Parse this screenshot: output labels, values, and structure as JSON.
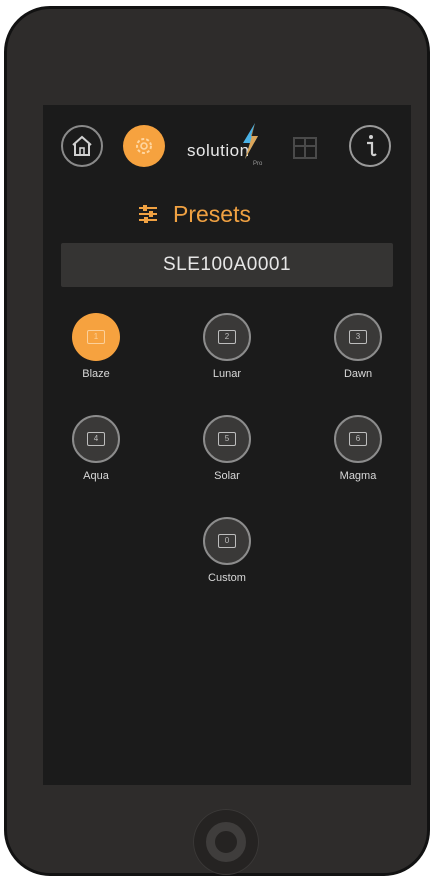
{
  "logo": {
    "text": "solution",
    "sub": "Pro"
  },
  "header": {
    "title": "Presets"
  },
  "device": {
    "id": "SLE100A0001"
  },
  "presets": [
    {
      "label": "Blaze",
      "number": "1",
      "active": true
    },
    {
      "label": "Lunar",
      "number": "2",
      "active": false
    },
    {
      "label": "Dawn",
      "number": "3",
      "active": false
    },
    {
      "label": "Aqua",
      "number": "4",
      "active": false
    },
    {
      "label": "Solar",
      "number": "5",
      "active": false
    },
    {
      "label": "Magma",
      "number": "6",
      "active": false
    },
    {
      "label": "Custom",
      "number": "0",
      "active": false
    }
  ],
  "colors": {
    "accent": "#f6a23f",
    "screen": "#1b1b1b",
    "bar": "#353433"
  },
  "icons": [
    "home-icon",
    "gear-icon",
    "lightning-icon",
    "box-icon",
    "info-icon",
    "sliders-icon",
    "monitor-icon"
  ]
}
